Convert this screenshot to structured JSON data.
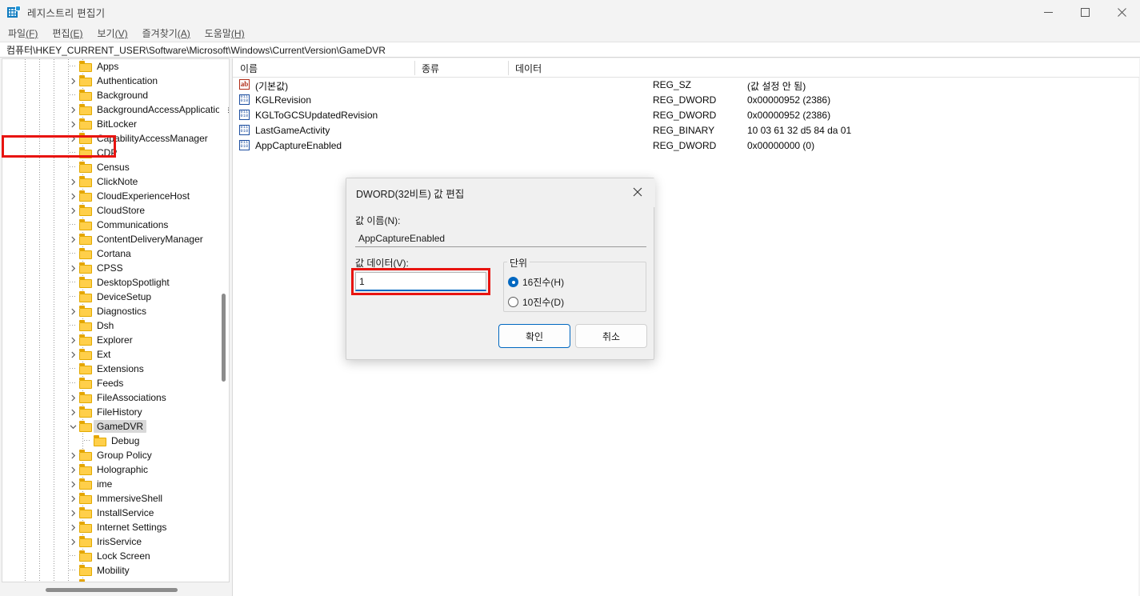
{
  "window": {
    "title": "레지스트리 편집기",
    "icon": "registry-editor-icon",
    "minimize": "minimize-icon",
    "maximize": "maximize-icon",
    "close": "close-icon"
  },
  "menubar": {
    "items": [
      {
        "label": "파일",
        "accel": "(F)"
      },
      {
        "label": "편집",
        "accel": "(E)"
      },
      {
        "label": "보기",
        "accel": "(V)"
      },
      {
        "label": "즐겨찾기",
        "accel": "(A)"
      },
      {
        "label": "도움말",
        "accel": "(H)"
      }
    ]
  },
  "address": {
    "path": "컴퓨터\\HKEY_CURRENT_USER\\Software\\Microsoft\\Windows\\CurrentVersion\\GameDVR"
  },
  "tree": {
    "items": [
      {
        "label": "Apps",
        "indent": 5,
        "expander": "none"
      },
      {
        "label": "Authentication",
        "indent": 5,
        "expander": "collapsed"
      },
      {
        "label": "Background",
        "indent": 5,
        "expander": "none"
      },
      {
        "label": "BackgroundAccessApplications",
        "indent": 5,
        "expander": "collapsed"
      },
      {
        "label": "BitLocker",
        "indent": 5,
        "expander": "collapsed"
      },
      {
        "label": "CapabilityAccessManager",
        "indent": 5,
        "expander": "collapsed"
      },
      {
        "label": "CDP",
        "indent": 5,
        "expander": "none"
      },
      {
        "label": "Census",
        "indent": 5,
        "expander": "none"
      },
      {
        "label": "ClickNote",
        "indent": 5,
        "expander": "collapsed"
      },
      {
        "label": "CloudExperienceHost",
        "indent": 5,
        "expander": "collapsed"
      },
      {
        "label": "CloudStore",
        "indent": 5,
        "expander": "collapsed"
      },
      {
        "label": "Communications",
        "indent": 5,
        "expander": "none"
      },
      {
        "label": "ContentDeliveryManager",
        "indent": 5,
        "expander": "collapsed"
      },
      {
        "label": "Cortana",
        "indent": 5,
        "expander": "none"
      },
      {
        "label": "CPSS",
        "indent": 5,
        "expander": "collapsed"
      },
      {
        "label": "DesktopSpotlight",
        "indent": 5,
        "expander": "none"
      },
      {
        "label": "DeviceSetup",
        "indent": 5,
        "expander": "none"
      },
      {
        "label": "Diagnostics",
        "indent": 5,
        "expander": "collapsed"
      },
      {
        "label": "Dsh",
        "indent": 5,
        "expander": "none"
      },
      {
        "label": "Explorer",
        "indent": 5,
        "expander": "collapsed"
      },
      {
        "label": "Ext",
        "indent": 5,
        "expander": "collapsed"
      },
      {
        "label": "Extensions",
        "indent": 5,
        "expander": "none"
      },
      {
        "label": "Feeds",
        "indent": 5,
        "expander": "none"
      },
      {
        "label": "FileAssociations",
        "indent": 5,
        "expander": "collapsed"
      },
      {
        "label": "FileHistory",
        "indent": 5,
        "expander": "collapsed"
      },
      {
        "label": "GameDVR",
        "indent": 5,
        "expander": "expanded",
        "selected": true
      },
      {
        "label": "Debug",
        "indent": 6,
        "expander": "none"
      },
      {
        "label": "Group Policy",
        "indent": 5,
        "expander": "collapsed"
      },
      {
        "label": "Holographic",
        "indent": 5,
        "expander": "collapsed"
      },
      {
        "label": "ime",
        "indent": 5,
        "expander": "collapsed"
      },
      {
        "label": "ImmersiveShell",
        "indent": 5,
        "expander": "collapsed"
      },
      {
        "label": "InstallService",
        "indent": 5,
        "expander": "collapsed"
      },
      {
        "label": "Internet Settings",
        "indent": 5,
        "expander": "collapsed"
      },
      {
        "label": "IrisService",
        "indent": 5,
        "expander": "collapsed"
      },
      {
        "label": "Lock Screen",
        "indent": 5,
        "expander": "none"
      },
      {
        "label": "Mobility",
        "indent": 5,
        "expander": "none"
      },
      {
        "label": "",
        "indent": 5,
        "expander": "none"
      }
    ]
  },
  "list": {
    "columns": [
      {
        "label": "이름"
      },
      {
        "label": "종류"
      },
      {
        "label": "데이터"
      }
    ],
    "rows": [
      {
        "icon": "string-value-icon",
        "name": "(기본값)",
        "type": "REG_SZ",
        "data": "(값 설정 안 됨)"
      },
      {
        "icon": "dword-value-icon",
        "name": "KGLRevision",
        "type": "REG_DWORD",
        "data": "0x00000952 (2386)"
      },
      {
        "icon": "dword-value-icon",
        "name": "KGLToGCSUpdatedRevision",
        "type": "REG_DWORD",
        "data": "0x00000952 (2386)"
      },
      {
        "icon": "dword-value-icon",
        "name": "LastGameActivity",
        "type": "REG_BINARY",
        "data": "10 03 61 32 d5 84 da 01"
      },
      {
        "icon": "dword-value-icon",
        "name": "AppCaptureEnabled",
        "type": "REG_DWORD",
        "data": "0x00000000 (0)",
        "highlighted": true
      }
    ]
  },
  "dialog": {
    "title": "DWORD(32비트) 값 편집",
    "close": "close-icon",
    "name_label": "값 이름(N):",
    "name_value": "AppCaptureEnabled",
    "data_label": "값 데이터(V):",
    "data_value": "1",
    "group_title": "단위",
    "radio_hex": "16진수(H)",
    "radio_dec": "10진수(D)",
    "radio_selected": "hex",
    "ok_label": "확인",
    "cancel_label": "취소"
  },
  "colors": {
    "accent": "#0067c0",
    "annotation": "#e81410",
    "folder": "#ffcf4a",
    "selection": "#d8d8d8"
  }
}
